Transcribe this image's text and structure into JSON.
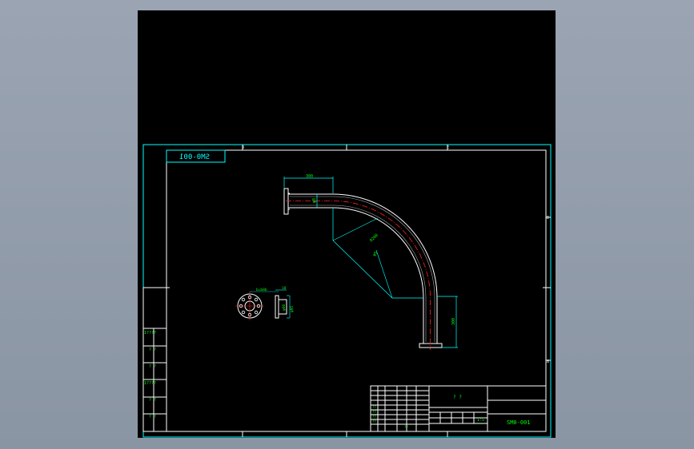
{
  "drawing": {
    "mirrored_code": "SM0-001",
    "title_code": "SM0-001",
    "title_name": "? ?",
    "border_zone_markers": [
      "8",
      "E",
      "D",
      "8"
    ],
    "left_panel_labels": [
      "1????",
      "? ?",
      "? ?",
      "1????",
      "? ?",
      "? ?"
    ],
    "dimensions": {
      "pipe_straight_length": "300",
      "flange_height": "φ8",
      "bend_radius": "R200",
      "bend_label": "φ5",
      "vertical_leg": "300",
      "flange_face_width": "b=b8b",
      "flange_thickness": "18",
      "flange_dia_1": "φ95",
      "flange_dia_2": "φ60"
    },
    "title_block": {
      "grid_row_labels": [
        "??",
        "??",
        "??",
        "??",
        "??"
      ],
      "scale_label": "1:5"
    }
  },
  "colors": {
    "background": "#000000",
    "frame": "#00ffff",
    "geometry": "#ffffff",
    "centerline": "#ff2020",
    "dimension_text": "#00ff00",
    "workspace": "#8e99a8"
  }
}
